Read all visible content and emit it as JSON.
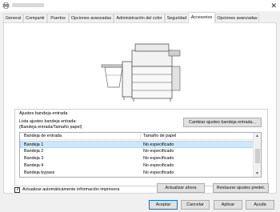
{
  "tabs": [
    "General",
    "Compartir",
    "Puertos",
    "Opciones avanzadas",
    "Administración del color",
    "Seguridad",
    "Accesorios",
    "Opciones avanzadas"
  ],
  "active_tab": "Accesorios",
  "tray_group": {
    "title": "Ajustes bandeja entrada",
    "list_label_line1": "Lista ajustes bandeja entrada:",
    "list_label_line2": "(Bandeja entrada/Tamaño papel)",
    "change_button": "Cambiar ajustes bandeja entrada...",
    "columns": [
      "Bandeja de entrada",
      "Tamaño de papel"
    ],
    "rows": [
      {
        "tray": "Bandeja 1",
        "size": "No especificado",
        "selected": true
      },
      {
        "tray": "Bandeja 2",
        "size": "No especificado",
        "selected": false
      },
      {
        "tray": "Bandeja 3",
        "size": "No especificado",
        "selected": false
      },
      {
        "tray": "Bandeja 4",
        "size": "No especificado",
        "selected": false
      },
      {
        "tray": "Bandeja bypass",
        "size": "No especificado",
        "selected": false
      }
    ]
  },
  "auto_update": {
    "label": "Actualizar automáticamente información impresora",
    "checked": true
  },
  "buttons": {
    "update_now": "Actualizar ahora",
    "restore": "Restaurar ajustes predet.",
    "ok": "Aceptar",
    "cancel": "Cancelar",
    "apply": "Aplicar",
    "help": "Ayuda"
  },
  "colors": {
    "selection": "#cce8ff",
    "accent": "#0078d7"
  }
}
